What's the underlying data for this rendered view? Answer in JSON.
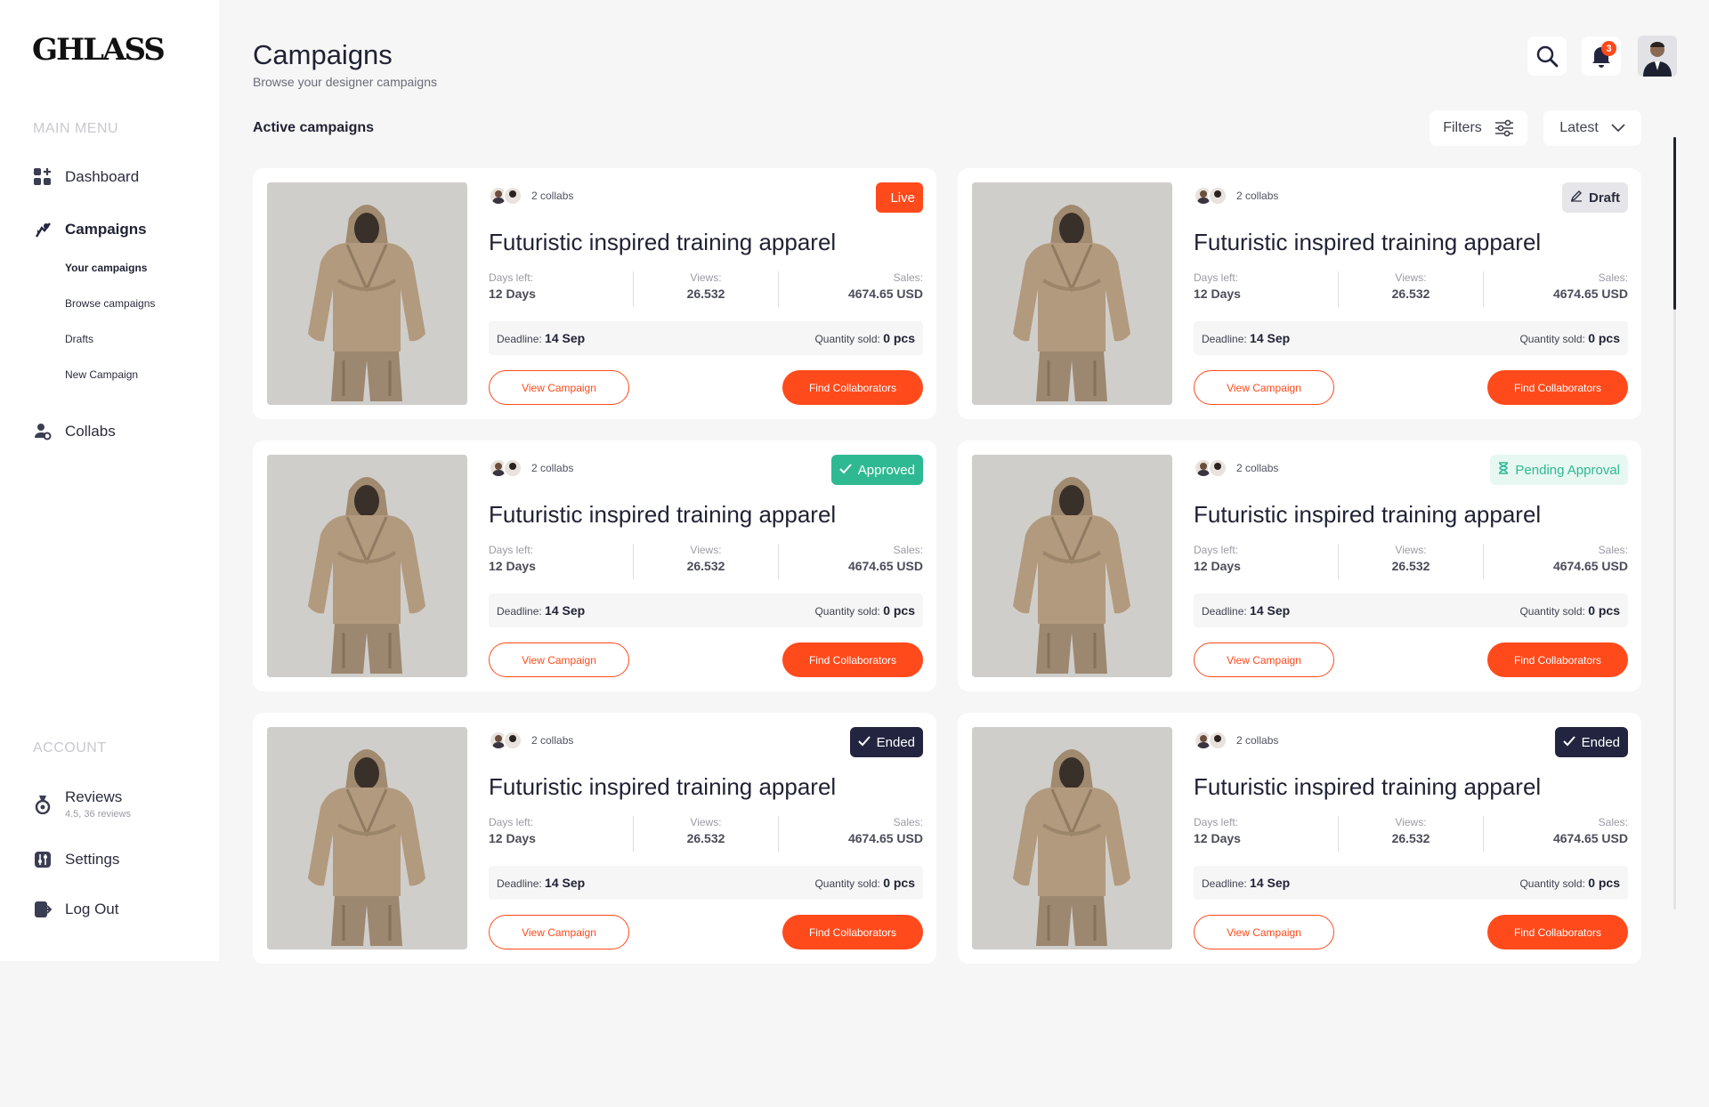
{
  "app": {
    "logo": "GHLASS"
  },
  "sidebar": {
    "main_menu_label": "MAIN MENU",
    "account_label": "ACCOUNT",
    "items": {
      "dashboard": "Dashboard",
      "campaigns": "Campaigns",
      "collabs": "Collabs",
      "reviews": "Reviews",
      "reviews_sub": "4.5, 36 reviews",
      "settings": "Settings",
      "logout": "Log Out"
    },
    "campaign_sub": {
      "your": "Your campaigns",
      "browse": "Browse campaigns",
      "drafts": "Drafts",
      "new": "New Campaign"
    }
  },
  "header": {
    "title": "Campaigns",
    "subtitle": "Browse your designer campaigns",
    "notification_count": "3"
  },
  "toolbar": {
    "section_title": "Active campaigns",
    "filters_label": "Filters",
    "sort_label": "Latest"
  },
  "colors": {
    "accent": "#ff4a1c",
    "approved": "#2fb992",
    "ended": "#232540"
  },
  "campaigns": [
    {
      "status": "Live",
      "status_type": "live"
    },
    {
      "status": "Draft",
      "status_type": "draft"
    },
    {
      "status": "Approved",
      "status_type": "approved"
    },
    {
      "status": "Pending Approval",
      "status_type": "pending"
    },
    {
      "status": "Ended",
      "status_type": "ended"
    },
    {
      "status": "Ended",
      "status_type": "ended"
    }
  ],
  "card": {
    "collabs": "2 collabs",
    "title": "Futuristic inspired training apparel",
    "days_label": "Days left:",
    "days_value": "12 Days",
    "views_label": "Views:",
    "views_value": "26.532",
    "sales_label": "Sales:",
    "sales_value": "4674.65 USD",
    "deadline_label": "Deadline:",
    "deadline_value": "14 Sep",
    "qty_label": "Quantity sold:",
    "qty_value": "0 pcs",
    "view_btn": "View Campaign",
    "find_btn": "Find Collaborators"
  }
}
